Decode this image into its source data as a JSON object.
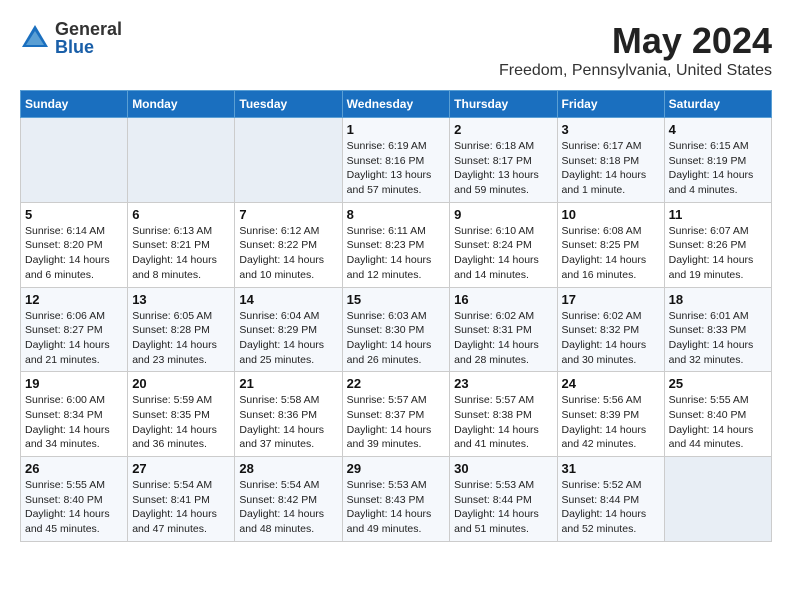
{
  "header": {
    "logo_general": "General",
    "logo_blue": "Blue",
    "month": "May 2024",
    "location": "Freedom, Pennsylvania, United States"
  },
  "days_of_week": [
    "Sunday",
    "Monday",
    "Tuesday",
    "Wednesday",
    "Thursday",
    "Friday",
    "Saturday"
  ],
  "weeks": [
    [
      {
        "day": "",
        "info": ""
      },
      {
        "day": "",
        "info": ""
      },
      {
        "day": "",
        "info": ""
      },
      {
        "day": "1",
        "info": "Sunrise: 6:19 AM\nSunset: 8:16 PM\nDaylight: 13 hours\nand 57 minutes."
      },
      {
        "day": "2",
        "info": "Sunrise: 6:18 AM\nSunset: 8:17 PM\nDaylight: 13 hours\nand 59 minutes."
      },
      {
        "day": "3",
        "info": "Sunrise: 6:17 AM\nSunset: 8:18 PM\nDaylight: 14 hours\nand 1 minute."
      },
      {
        "day": "4",
        "info": "Sunrise: 6:15 AM\nSunset: 8:19 PM\nDaylight: 14 hours\nand 4 minutes."
      }
    ],
    [
      {
        "day": "5",
        "info": "Sunrise: 6:14 AM\nSunset: 8:20 PM\nDaylight: 14 hours\nand 6 minutes."
      },
      {
        "day": "6",
        "info": "Sunrise: 6:13 AM\nSunset: 8:21 PM\nDaylight: 14 hours\nand 8 minutes."
      },
      {
        "day": "7",
        "info": "Sunrise: 6:12 AM\nSunset: 8:22 PM\nDaylight: 14 hours\nand 10 minutes."
      },
      {
        "day": "8",
        "info": "Sunrise: 6:11 AM\nSunset: 8:23 PM\nDaylight: 14 hours\nand 12 minutes."
      },
      {
        "day": "9",
        "info": "Sunrise: 6:10 AM\nSunset: 8:24 PM\nDaylight: 14 hours\nand 14 minutes."
      },
      {
        "day": "10",
        "info": "Sunrise: 6:08 AM\nSunset: 8:25 PM\nDaylight: 14 hours\nand 16 minutes."
      },
      {
        "day": "11",
        "info": "Sunrise: 6:07 AM\nSunset: 8:26 PM\nDaylight: 14 hours\nand 19 minutes."
      }
    ],
    [
      {
        "day": "12",
        "info": "Sunrise: 6:06 AM\nSunset: 8:27 PM\nDaylight: 14 hours\nand 21 minutes."
      },
      {
        "day": "13",
        "info": "Sunrise: 6:05 AM\nSunset: 8:28 PM\nDaylight: 14 hours\nand 23 minutes."
      },
      {
        "day": "14",
        "info": "Sunrise: 6:04 AM\nSunset: 8:29 PM\nDaylight: 14 hours\nand 25 minutes."
      },
      {
        "day": "15",
        "info": "Sunrise: 6:03 AM\nSunset: 8:30 PM\nDaylight: 14 hours\nand 26 minutes."
      },
      {
        "day": "16",
        "info": "Sunrise: 6:02 AM\nSunset: 8:31 PM\nDaylight: 14 hours\nand 28 minutes."
      },
      {
        "day": "17",
        "info": "Sunrise: 6:02 AM\nSunset: 8:32 PM\nDaylight: 14 hours\nand 30 minutes."
      },
      {
        "day": "18",
        "info": "Sunrise: 6:01 AM\nSunset: 8:33 PM\nDaylight: 14 hours\nand 32 minutes."
      }
    ],
    [
      {
        "day": "19",
        "info": "Sunrise: 6:00 AM\nSunset: 8:34 PM\nDaylight: 14 hours\nand 34 minutes."
      },
      {
        "day": "20",
        "info": "Sunrise: 5:59 AM\nSunset: 8:35 PM\nDaylight: 14 hours\nand 36 minutes."
      },
      {
        "day": "21",
        "info": "Sunrise: 5:58 AM\nSunset: 8:36 PM\nDaylight: 14 hours\nand 37 minutes."
      },
      {
        "day": "22",
        "info": "Sunrise: 5:57 AM\nSunset: 8:37 PM\nDaylight: 14 hours\nand 39 minutes."
      },
      {
        "day": "23",
        "info": "Sunrise: 5:57 AM\nSunset: 8:38 PM\nDaylight: 14 hours\nand 41 minutes."
      },
      {
        "day": "24",
        "info": "Sunrise: 5:56 AM\nSunset: 8:39 PM\nDaylight: 14 hours\nand 42 minutes."
      },
      {
        "day": "25",
        "info": "Sunrise: 5:55 AM\nSunset: 8:40 PM\nDaylight: 14 hours\nand 44 minutes."
      }
    ],
    [
      {
        "day": "26",
        "info": "Sunrise: 5:55 AM\nSunset: 8:40 PM\nDaylight: 14 hours\nand 45 minutes."
      },
      {
        "day": "27",
        "info": "Sunrise: 5:54 AM\nSunset: 8:41 PM\nDaylight: 14 hours\nand 47 minutes."
      },
      {
        "day": "28",
        "info": "Sunrise: 5:54 AM\nSunset: 8:42 PM\nDaylight: 14 hours\nand 48 minutes."
      },
      {
        "day": "29",
        "info": "Sunrise: 5:53 AM\nSunset: 8:43 PM\nDaylight: 14 hours\nand 49 minutes."
      },
      {
        "day": "30",
        "info": "Sunrise: 5:53 AM\nSunset: 8:44 PM\nDaylight: 14 hours\nand 51 minutes."
      },
      {
        "day": "31",
        "info": "Sunrise: 5:52 AM\nSunset: 8:44 PM\nDaylight: 14 hours\nand 52 minutes."
      },
      {
        "day": "",
        "info": ""
      }
    ]
  ]
}
